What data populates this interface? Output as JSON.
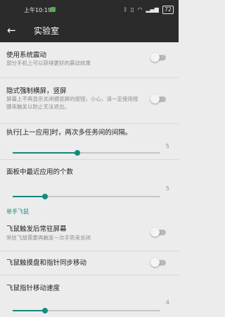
{
  "status_bar": {
    "time": "上午10:19",
    "battery": "72",
    "icons": [
      "bluetooth-icon",
      "vibrate-icon",
      "wifi-icon",
      "signal-icon",
      "battery-icon"
    ]
  },
  "toolbar": {
    "title": "实验室",
    "back_icon": "arrow-left"
  },
  "prefs": {
    "system_vibration": {
      "title": "使用系统震动",
      "summary": "部分手机上可以获得更好的震动效果",
      "enabled": false
    },
    "immersive": {
      "title": "隐式强制横屏，竖屏",
      "summary": "屏幕上不再显示关闭横竖屏的按钮，小心，请一定使用按键来触发以防止无法退出。",
      "enabled": false
    },
    "recent_interval": {
      "title": "执行[上一应用]时，两次多任务间的间隔。",
      "value": "5",
      "fraction": 0.44
    },
    "recent_count": {
      "title": "面板中最近应用的个数",
      "value": "5",
      "fraction": 0.22
    }
  },
  "section": {
    "title": "单手飞鼠"
  },
  "mouse_prefs": {
    "resident": {
      "title": "飞鼠触发后常驻屏幕",
      "summary": "常驻飞鼠需要再触发一次手势来关闭",
      "enabled": false
    },
    "sync_move": {
      "title": "飞鼠触摸盘和指针同步移动",
      "enabled": false
    },
    "speed": {
      "title": "飞鼠指针移动速度",
      "value": "4",
      "fraction": 0.22
    }
  },
  "accent_color": "#16897d"
}
